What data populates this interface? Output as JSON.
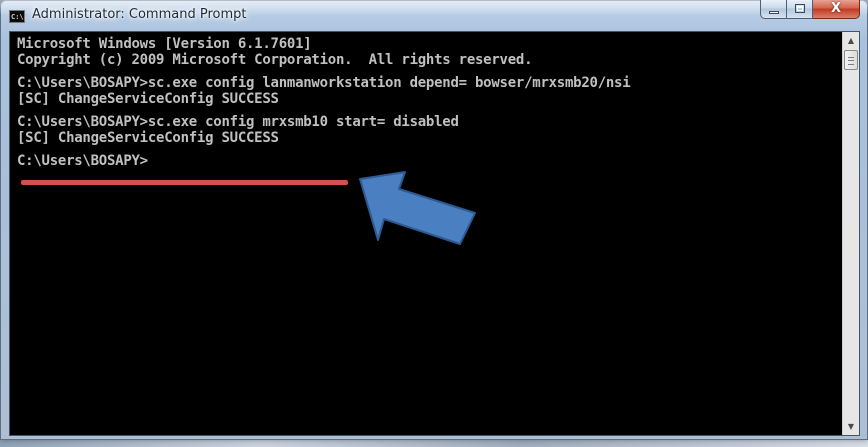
{
  "window": {
    "title": "Administrator: Command Prompt",
    "app_icon_text": "C:\\."
  },
  "caption_buttons": {
    "minimize": "",
    "maximize": "",
    "close": "X"
  },
  "console": {
    "lines": [
      "Microsoft Windows [Version 6.1.7601]",
      "Copyright (c) 2009 Microsoft Corporation.  All rights reserved.",
      "",
      "C:\\Users\\BOSAPY>sc.exe config lanmanworkstation depend= bowser/mrxsmb20/nsi",
      "[SC] ChangeServiceConfig SUCCESS",
      "",
      "C:\\Users\\BOSAPY>sc.exe config mrxsmb10 start= disabled",
      "[SC] ChangeServiceConfig SUCCESS",
      "",
      "C:\\Users\\BOSAPY>"
    ]
  },
  "annotations": {
    "underline_color": "#d4504b",
    "arrow_color": "#4a7fc1",
    "arrow_outline": "#2d5a93"
  },
  "scrollbar": {
    "up_icon": "▲",
    "down_icon": "▼"
  }
}
